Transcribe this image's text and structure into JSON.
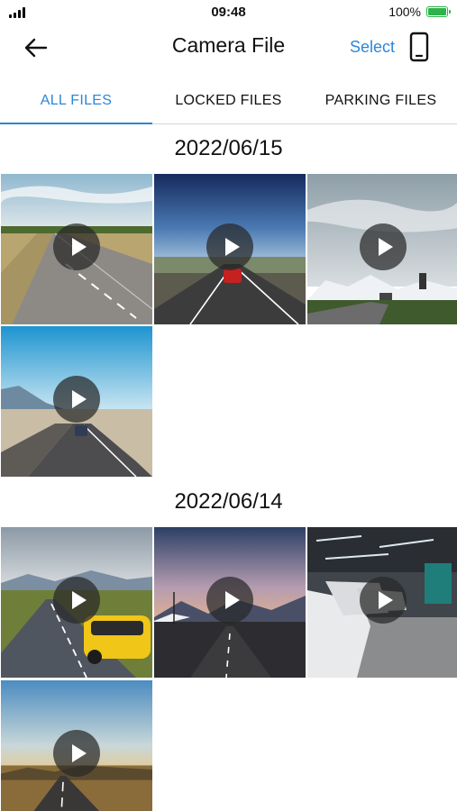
{
  "status_bar": {
    "time": "09:48",
    "battery": "100%",
    "battery_level": 1.0
  },
  "header": {
    "title": "Camera File",
    "select_label": "Select",
    "back_icon": "back-arrow-icon",
    "device_icon": "phone-icon"
  },
  "tabs": [
    {
      "label": "ALL FILES",
      "active": true
    },
    {
      "label": "LOCKED FILES",
      "active": false
    },
    {
      "label": "PARKING FILES",
      "active": false
    }
  ],
  "accent_color": "#2d86d8",
  "sections": [
    {
      "date": "2022/06/15",
      "video_count": 4
    },
    {
      "date": "2022/06/14",
      "video_count": 4
    }
  ]
}
